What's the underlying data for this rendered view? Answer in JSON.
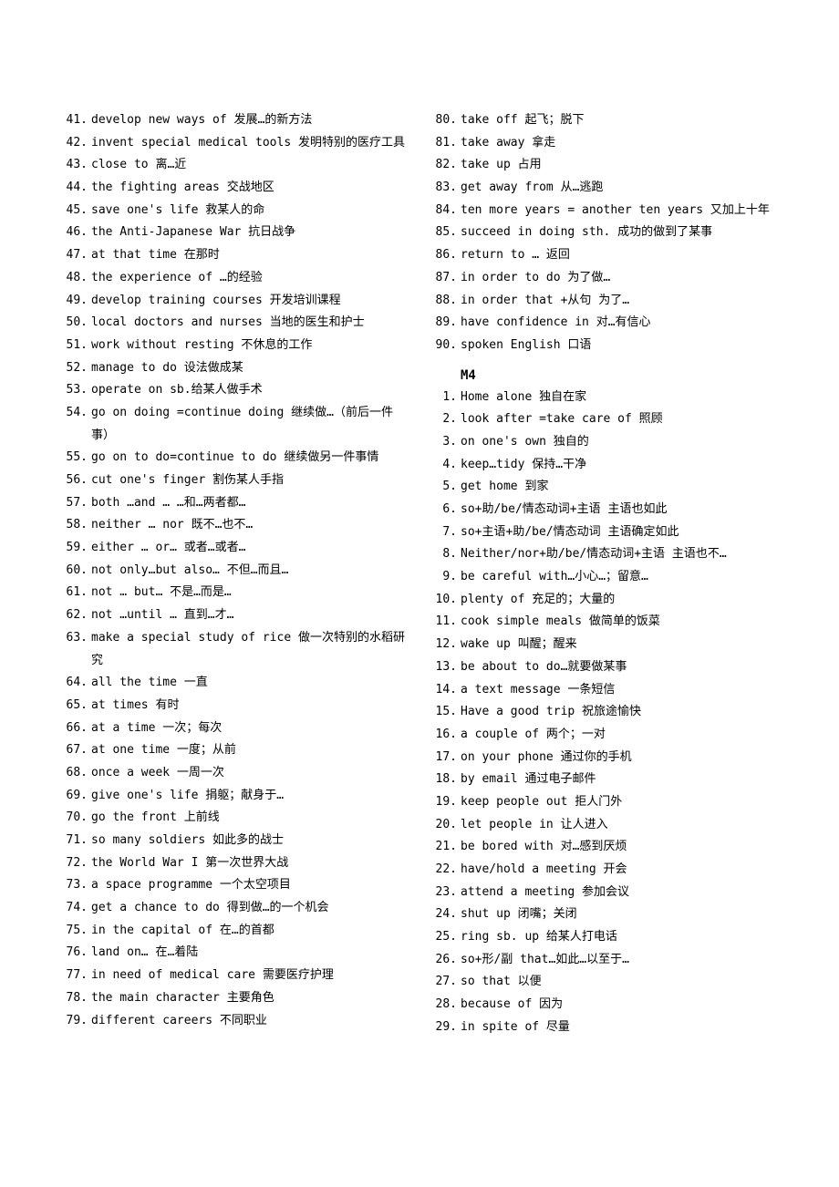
{
  "left": {
    "start": 41,
    "items": [
      "develop new ways of 发展…的新方法",
      "invent special medical tools 发明特别的医疗工具",
      "close to 离…近",
      "the fighting areas 交战地区",
      "save one's life 救某人的命",
      "the Anti-Japanese War 抗日战争",
      "at that time 在那时",
      "the experience of  …的经验",
      "develop training courses 开发培训课程",
      "local doctors and nurses 当地的医生和护士",
      "work without resting 不休息的工作",
      "manage to do 设法做成某",
      "operate on sb.给某人做手术",
      "go on doing =continue doing 继续做…（前后一件事）",
      "go on to do=continue to do 继续做另一件事情",
      "cut one's finger 割伤某人手指",
      "both …and … …和…两者都…",
      "neither … nor 既不…也不…",
      "either … or… 或者…或者…",
      "not only…but also… 不但…而且…",
      "not … but… 不是…而是…",
      "not …until … 直到…才…",
      "make a special study of rice 做一次特别的水稻研究",
      "all the time 一直",
      "at times 有时",
      "at a time 一次；每次",
      "at one time 一度；从前",
      "once a week 一周一次",
      "give one's life 捐躯；献身于…",
      "go the front 上前线",
      "so many soldiers 如此多的战士",
      "the World War I 第一次世界大战",
      "a space programme 一个太空项目",
      "get a chance to do 得到做…的一个机会",
      "in the capital of 在…的首都",
      "land on… 在…着陆",
      "in need of medical care 需要医疗护理",
      "the main character 主要角色",
      "different careers 不同职业"
    ]
  },
  "rightTop": {
    "start": 80,
    "items": [
      "take off 起飞；脱下",
      "take away 拿走",
      "take up 占用",
      "get away from 从…逃跑",
      "ten more years = another ten years 又加上十年",
      "succeed in doing sth. 成功的做到了某事",
      "return to … 返回",
      "in order to do 为了做…",
      "in order that +从句 为了…",
      "have confidence in 对…有信心",
      "spoken English 口语"
    ]
  },
  "section2Heading": "M4",
  "rightBottom": {
    "start": 1,
    "items": [
      "Home alone 独自在家",
      "look after =take care of 照顾",
      "on one's own 独自的",
      "keep…tidy 保持…干净",
      "get home 到家",
      "so+助/be/情态动词+主语  主语也如此",
      "so+主语+助/be/情态动词  主语确定如此",
      "Neither/nor+助/be/情态动词+主语 主语也不…",
      "be careful with…小心…；留意…",
      "plenty of 充足的；大量的",
      "cook simple meals 做简单的饭菜",
      "wake up 叫醒；醒来",
      "be about to do…就要做某事",
      "a text message 一条短信",
      "Have a good trip 祝旅途愉快",
      "a couple of 两个；一对",
      "on your phone 通过你的手机",
      "by email 通过电子邮件",
      "keep people out 拒人门外",
      "let people in 让人进入",
      "be bored with 对…感到厌烦",
      "have/hold a meeting 开会",
      "attend a meeting 参加会议",
      "shut up 闭嘴；关闭",
      "ring sb. up 给某人打电话",
      "so+形/副 that…如此…以至于…",
      "so that 以便",
      "because of 因为",
      "in spite of 尽量"
    ]
  }
}
